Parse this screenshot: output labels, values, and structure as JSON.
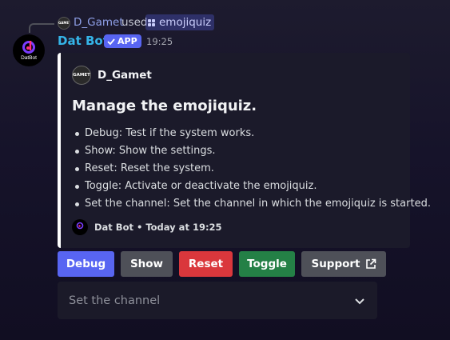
{
  "command": {
    "user_avatar_text": "GAMET",
    "user": "D_Gamet",
    "used_text": "used",
    "command_name": "emojiquiz"
  },
  "message": {
    "bot_name": "Dat Bot",
    "bot_avatar_text": "DatBot",
    "badge": "APP",
    "timestamp": "19:25"
  },
  "embed": {
    "border_color": "#ffffff",
    "author_avatar_text": "GAMET",
    "author": "D_Gamet",
    "title": "Manage the emojiquiz.",
    "items": [
      "Debug: Test if the system works.",
      "Show: Show the settings.",
      "Reset: Reset the system.",
      "Toggle: Activate or deactivate the emojiquiz.",
      "Set the channel: Set the channel in which the emojiquiz is started."
    ],
    "footer": "Dat Bot • Today at 19:25"
  },
  "buttons": {
    "debug": "Debug",
    "show": "Show",
    "reset": "Reset",
    "toggle": "Toggle",
    "support": "Support"
  },
  "select": {
    "placeholder": "Set the channel"
  },
  "colors": {
    "blurple": "#5865f2",
    "grey": "#4e5058",
    "red": "#da373c",
    "green": "#248046",
    "bot_name": "#35b4e8"
  }
}
